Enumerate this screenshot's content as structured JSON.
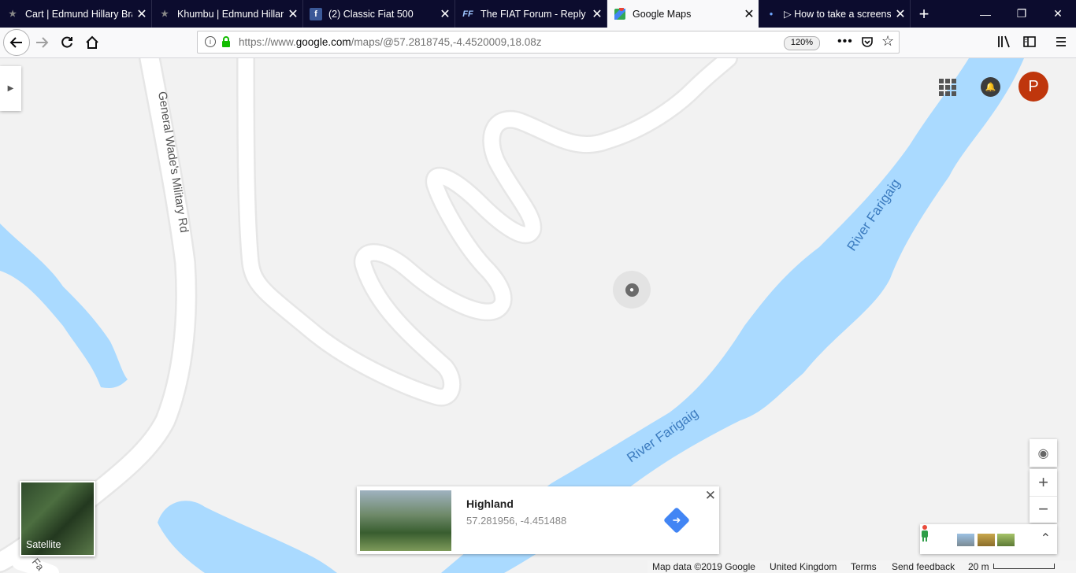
{
  "browser": {
    "tabs": [
      {
        "title": "Cart | Edmund Hillary Bra",
        "active": false
      },
      {
        "title": "Khumbu | Edmund Hillar",
        "active": false
      },
      {
        "title": "(2) Classic Fiat 500",
        "active": false
      },
      {
        "title": "The FIAT Forum - Reply t",
        "active": false
      },
      {
        "title": "Google Maps",
        "active": true
      },
      {
        "title": "▷ How to take a screens",
        "active": false
      }
    ],
    "url_prefix": "https://www.",
    "url_domain": "google.com",
    "url_path": "/maps/@57.2818745,-4.4520009,18.08z",
    "zoom": "120%"
  },
  "map": {
    "road_label": "General Wade's Military Rd",
    "road_label_2": "Fa",
    "river_label_upper": "River Farigaig",
    "river_label_lower": "River Farigaig",
    "colors": {
      "land": "#f2f2f2",
      "water": "#aadaff",
      "road": "#ffffff",
      "road_edge": "#e4e4e4"
    }
  },
  "account": {
    "avatar_letter": "P",
    "avatar_color": "#bf360c"
  },
  "layer_toggle": {
    "label": "Satellite"
  },
  "place_card": {
    "name": "Highland",
    "coords": "57.281956, -4.451488"
  },
  "footer": {
    "map_data": "Map data ©2019 Google",
    "region": "United Kingdom",
    "terms": "Terms",
    "feedback": "Send feedback",
    "scale": "20 m"
  }
}
